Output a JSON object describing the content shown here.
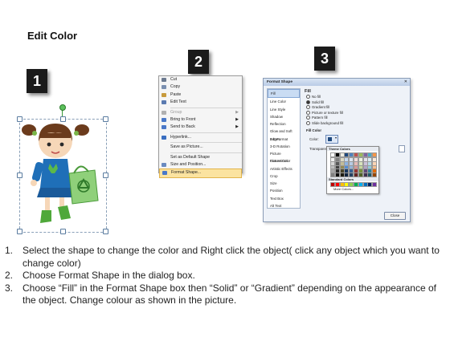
{
  "title": "Edit Color",
  "step_badges": [
    "1",
    "2",
    "3"
  ],
  "context_menu": {
    "items": [
      {
        "label": "Cut",
        "icon": "scissors-icon",
        "color": "#6c7a90",
        "disabled": false,
        "submenu": false,
        "sep_after": false,
        "highlighted": false
      },
      {
        "label": "Copy",
        "icon": "copy-icon",
        "color": "#7a8fb0",
        "disabled": false,
        "submenu": false,
        "sep_after": false,
        "highlighted": false
      },
      {
        "label": "Paste",
        "icon": "paste-icon",
        "color": "#c79a3c",
        "disabled": false,
        "submenu": false,
        "sep_after": false,
        "highlighted": false
      },
      {
        "label": "Edit Text",
        "icon": "edit-text-icon",
        "color": "#5a7ab0",
        "disabled": false,
        "submenu": false,
        "sep_after": true,
        "highlighted": false
      },
      {
        "label": "Group",
        "icon": "group-icon",
        "color": "#b0b0b0",
        "disabled": true,
        "submenu": true,
        "sep_after": false,
        "highlighted": false
      },
      {
        "label": "Bring to Front",
        "icon": "bring-to-front-icon",
        "color": "#4a78c8",
        "disabled": false,
        "submenu": true,
        "sep_after": false,
        "highlighted": false
      },
      {
        "label": "Send to Back",
        "icon": "send-to-back-icon",
        "color": "#4a78c8",
        "disabled": false,
        "submenu": true,
        "sep_after": true,
        "highlighted": false
      },
      {
        "label": "Hyperlink...",
        "icon": "hyperlink-icon",
        "color": "#3a6ec0",
        "disabled": false,
        "submenu": false,
        "sep_after": true,
        "highlighted": false
      },
      {
        "label": "Save as Picture...",
        "icon": "",
        "color": "",
        "disabled": false,
        "submenu": false,
        "sep_after": true,
        "highlighted": false
      },
      {
        "label": "Set as Default Shape",
        "icon": "",
        "color": "",
        "disabled": false,
        "submenu": false,
        "sep_after": false,
        "highlighted": false
      },
      {
        "label": "Size and Position...",
        "icon": "size-position-icon",
        "color": "#6a8ac0",
        "disabled": false,
        "submenu": false,
        "sep_after": false,
        "highlighted": false
      },
      {
        "label": "Format Shape...",
        "icon": "format-shape-icon",
        "color": "#4a78c8",
        "disabled": false,
        "submenu": false,
        "sep_after": false,
        "highlighted": true
      }
    ]
  },
  "dialog": {
    "title": "Format Shape",
    "close_symbol": "✕",
    "categories": [
      "Fill",
      "Line Color",
      "Line Style",
      "Shadow",
      "Reflection",
      "Glow and Soft Edges",
      "3-D Format",
      "3-D Rotation",
      "Picture Corrections",
      "Picture Color",
      "Artistic Effects",
      "Crop",
      "Size",
      "Position",
      "Text Box",
      "Alt Text"
    ],
    "selected_category": "Fill",
    "pane_heading": "Fill",
    "fill_options": [
      {
        "label": "No fill",
        "selected": false
      },
      {
        "label": "Solid fill",
        "selected": true
      },
      {
        "label": "Gradient fill",
        "selected": false
      },
      {
        "label": "Picture or texture fill",
        "selected": false
      },
      {
        "label": "Pattern fill",
        "selected": false
      },
      {
        "label": "Slide background fill",
        "selected": false
      }
    ],
    "fill_color_label": "Fill Color",
    "color_label": "Color:",
    "transparency_label": "Transparency:",
    "palette": {
      "theme_label": "Theme Colors",
      "standard_label": "Standard Colors",
      "more_label": "More Colors...",
      "theme_top": [
        "#ffffff",
        "#000000",
        "#eeece1",
        "#1f497d",
        "#4f81bd",
        "#c0504d",
        "#9bbb59",
        "#8064a2",
        "#4bacc6",
        "#f79646"
      ],
      "theme_shades": [
        [
          "#f2f2f2",
          "#7f7f7f",
          "#ddd9c3",
          "#c6d9f0",
          "#dbe5f1",
          "#f2dcdb",
          "#ebf1dd",
          "#e5e0ec",
          "#dbeef3",
          "#fdeada"
        ],
        [
          "#d8d8d8",
          "#595959",
          "#c4bd97",
          "#8db3e2",
          "#b8cce4",
          "#e5b9b7",
          "#d7e3bc",
          "#ccc1d9",
          "#b7dde8",
          "#fbd5b5"
        ],
        [
          "#bfbfbf",
          "#3f3f3f",
          "#938953",
          "#548dd4",
          "#95b3d7",
          "#d99694",
          "#c3d69b",
          "#b2a2c7",
          "#92cddc",
          "#fac08f"
        ],
        [
          "#a5a5a5",
          "#262626",
          "#494429",
          "#17365d",
          "#366092",
          "#953734",
          "#76923c",
          "#5f497a",
          "#31859b",
          "#e36c09"
        ],
        [
          "#7f7f7f",
          "#0c0c0c",
          "#1d1b10",
          "#0f243e",
          "#244061",
          "#632423",
          "#4f6128",
          "#3f3151",
          "#205867",
          "#974806"
        ]
      ],
      "standard": [
        "#c00000",
        "#ff0000",
        "#ffc000",
        "#ffff00",
        "#92d050",
        "#00b050",
        "#00b0f0",
        "#0070c0",
        "#002060",
        "#7030a0"
      ]
    },
    "close_label": "Close"
  },
  "steps": [
    {
      "num": "1.",
      "text": "Select the shape to change the color and Right click the object( click any object which you want to change color)"
    },
    {
      "num": "2.",
      "text": "Choose Format Shape in the dialog box."
    },
    {
      "num": "3.",
      "text": "Choose “Fill” in the Format Shape box then “Solid” or “Gradient” depending on the appearance of the object. Change colour as shown in the picture."
    }
  ]
}
